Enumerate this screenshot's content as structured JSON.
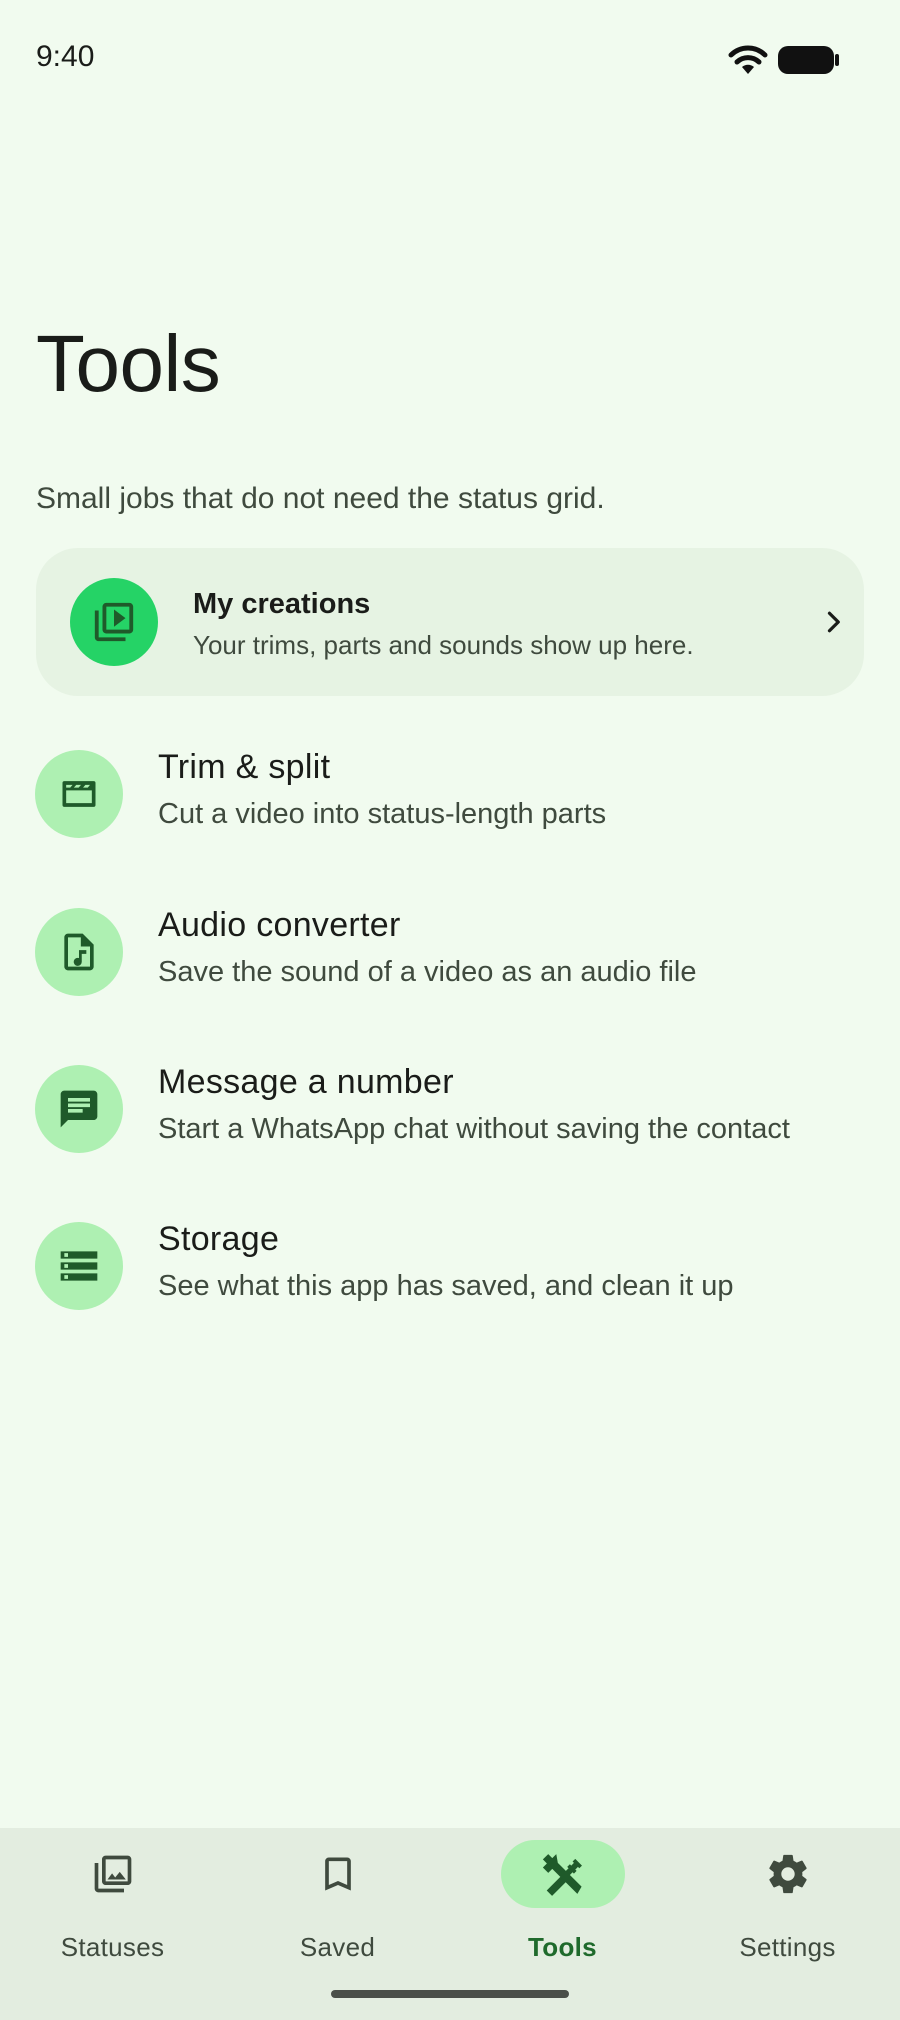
{
  "status_bar": {
    "time": "9:40",
    "icons": [
      "wifi-icon",
      "battery-icon"
    ]
  },
  "page": {
    "title": "Tools",
    "subtitle": "Small jobs that do not need the status grid."
  },
  "featured": {
    "title": "My creations",
    "description": "Your trims, parts and sounds show up here.",
    "icon": "video-library-icon"
  },
  "tools": [
    {
      "title": "Trim & split",
      "description": "Cut a video into status-length parts",
      "icon": "clapperboard-icon"
    },
    {
      "title": "Audio converter",
      "description": "Save the sound of a video as an audio file",
      "icon": "audio-file-icon"
    },
    {
      "title": "Message a number",
      "description": "Start a WhatsApp chat without saving the contact",
      "icon": "chat-icon"
    },
    {
      "title": "Storage",
      "description": "See what this app has saved, and clean it up",
      "icon": "storage-icon"
    }
  ],
  "bottom_nav": {
    "items": [
      {
        "label": "Statuses",
        "icon": "gallery-icon",
        "active": false
      },
      {
        "label": "Saved",
        "icon": "bookmark-icon",
        "active": false
      },
      {
        "label": "Tools",
        "icon": "tools-icon",
        "active": true
      },
      {
        "label": "Settings",
        "icon": "gear-icon",
        "active": false
      }
    ]
  },
  "colors": {
    "background": "#f1fbef",
    "accent": "#25d366",
    "icon_tint": "#aef0b2",
    "icon_dark": "#1f5a2a",
    "active_label": "#1f6a2c"
  }
}
